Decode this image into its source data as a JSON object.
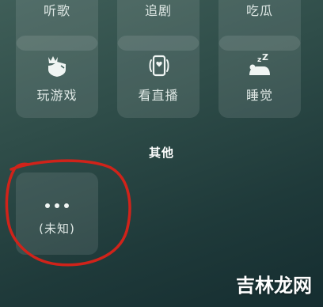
{
  "top_row": {
    "items": [
      {
        "label": "听歌",
        "icon": "music-icon"
      },
      {
        "label": "追剧",
        "icon": "tv-icon"
      },
      {
        "label": "吃瓜",
        "icon": "melon-icon"
      }
    ]
  },
  "activities": {
    "items": [
      {
        "label": "玩游戏",
        "icon": "game-icon"
      },
      {
        "label": "看直播",
        "icon": "live-stream-icon"
      },
      {
        "label": "睡觉",
        "icon": "sleep-icon"
      }
    ]
  },
  "other_section": {
    "title": "其他",
    "items": [
      {
        "label": "(未知)",
        "icon": "more-dots-icon"
      }
    ]
  },
  "annotation": {
    "color": "#d0231a"
  },
  "watermark": {
    "text": "吉林龙网"
  }
}
